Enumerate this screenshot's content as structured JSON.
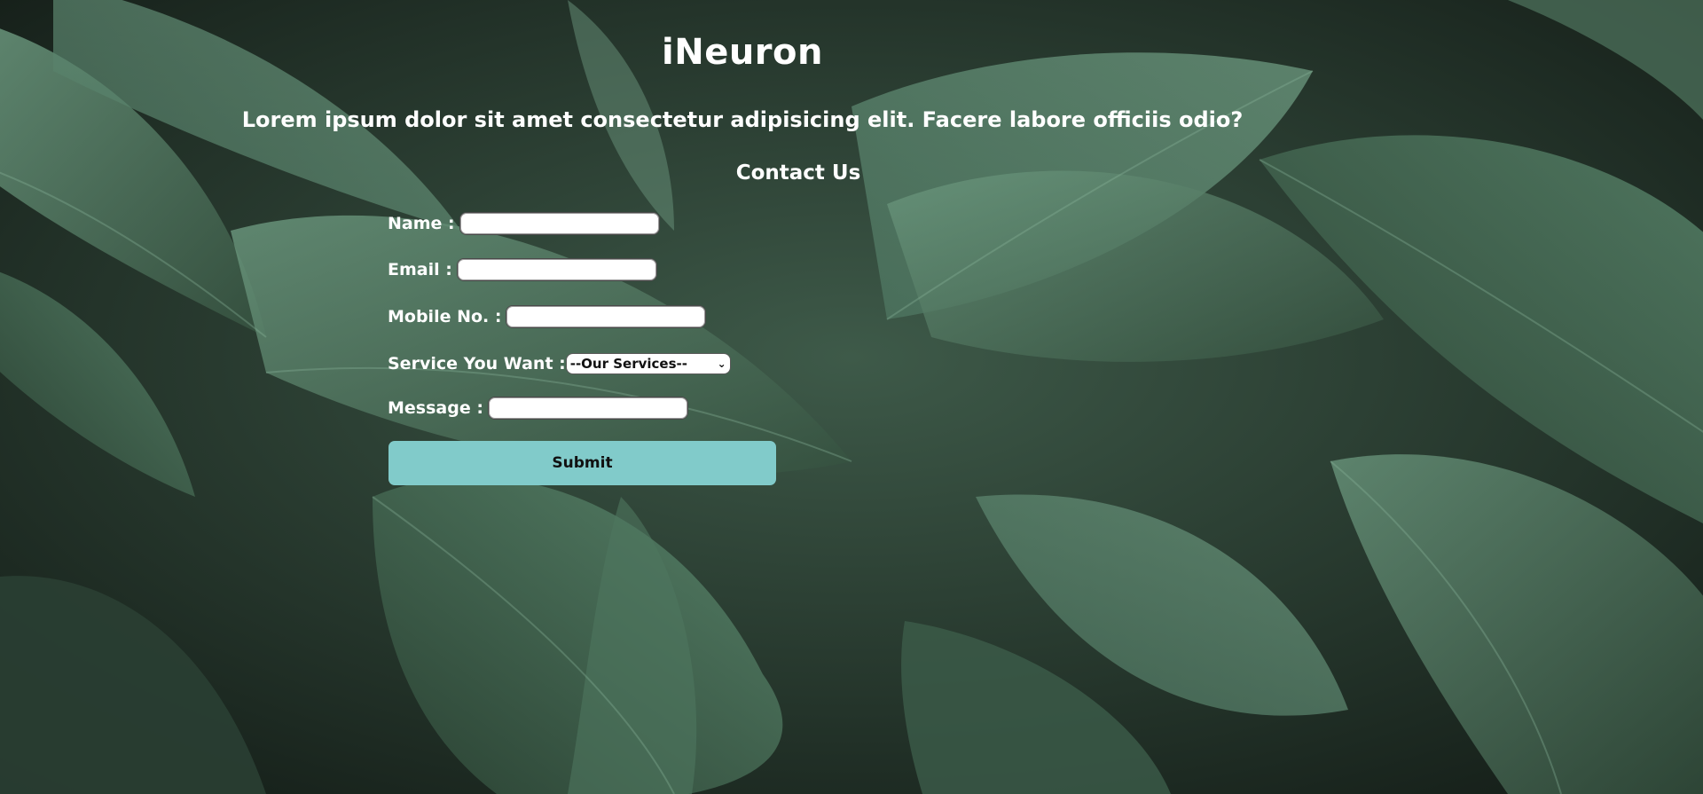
{
  "header": {
    "title": "iNeuron",
    "tagline": "Lorem ipsum dolor sit amet consectetur adipisicing elit. Facere labore officiis odio?"
  },
  "contact": {
    "heading": "Contact Us",
    "fields": {
      "name_label": "Name :",
      "email_label": "Email :",
      "mobile_label": "Mobile No. :",
      "service_label": "Service You Want :",
      "message_label": "Message :"
    },
    "service_select": {
      "selected": "--Our Services--"
    },
    "submit_label": "Submit"
  },
  "background": {
    "description_colors": [
      "#1f2c25",
      "#3f5e4c",
      "#5f8a72"
    ]
  }
}
